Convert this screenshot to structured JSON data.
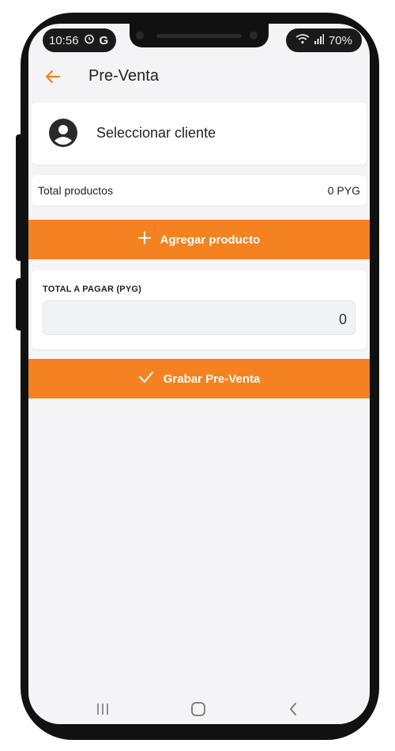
{
  "status_bar": {
    "time": "10:56",
    "battery": "70%",
    "left_icons": [
      "alarm-icon",
      "google-icon"
    ],
    "right_icons": [
      "wifi-icon",
      "signal-icon"
    ]
  },
  "app_bar": {
    "title": "Pre-Venta",
    "back_icon": "arrow-left-icon"
  },
  "client": {
    "label": "Seleccionar cliente",
    "icon": "user-avatar-icon"
  },
  "totals": {
    "label": "Total productos",
    "value": "0 PYG"
  },
  "add_product_button": {
    "label": "Agregar producto",
    "icon": "plus-icon"
  },
  "payment": {
    "label": "TOTAL A PAGAR (PYG)",
    "value": "0"
  },
  "save_button": {
    "label": "Grabar Pre-Venta",
    "icon": "check-icon"
  },
  "nav_bar": {
    "items": [
      "recents-icon",
      "home-icon",
      "back-icon"
    ]
  },
  "colors": {
    "accent": "#f58220",
    "background": "#f4f4f6",
    "card": "#ffffff",
    "text": "#222222"
  }
}
